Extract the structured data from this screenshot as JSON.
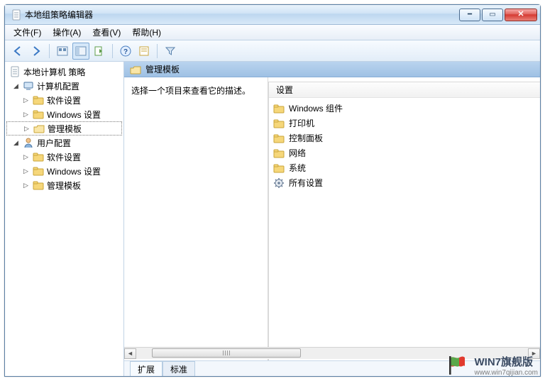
{
  "title": "本地组策略编辑器",
  "menus": {
    "file": "文件(F)",
    "action": "操作(A)",
    "view": "查看(V)",
    "help": "帮助(H)"
  },
  "tree": {
    "root": "本地计算机 策略",
    "computer": "计算机配置",
    "user": "用户配置",
    "children": {
      "soft": "软件设置",
      "win": "Windows 设置",
      "adm": "管理模板"
    }
  },
  "content": {
    "header": "管理模板",
    "desc": "选择一个项目来查看它的描述。",
    "column": "设置",
    "items": [
      {
        "name": "Windows 组件",
        "type": "folder"
      },
      {
        "name": "打印机",
        "type": "folder"
      },
      {
        "name": "控制面板",
        "type": "folder"
      },
      {
        "name": "网络",
        "type": "folder"
      },
      {
        "name": "系统",
        "type": "folder"
      },
      {
        "name": "所有设置",
        "type": "gear"
      }
    ]
  },
  "tabs": {
    "extended": "扩展",
    "standard": "标准"
  },
  "watermark": {
    "main": "WIN7旗舰版",
    "sub": "www.win7qijian.com"
  }
}
